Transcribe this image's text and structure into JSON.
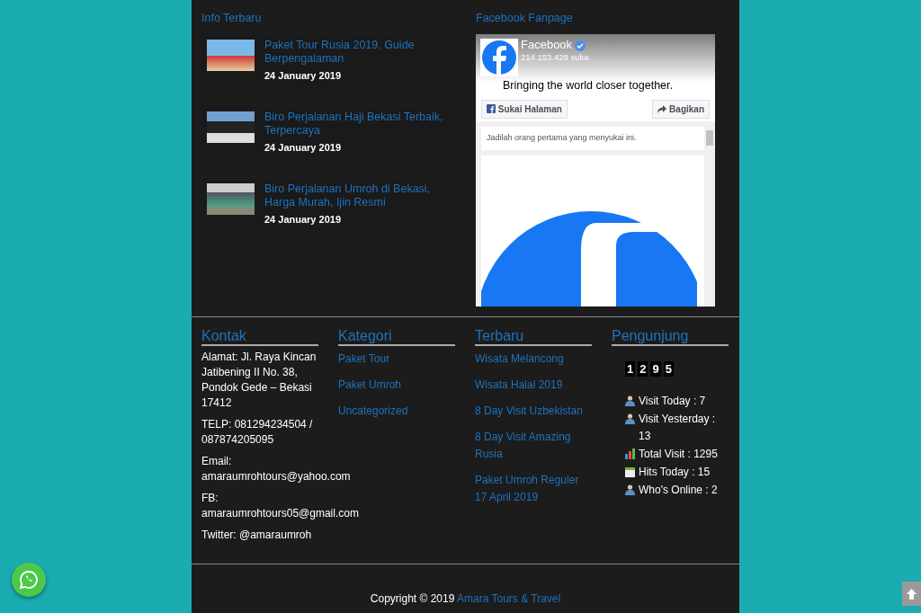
{
  "info_terbaru": {
    "title": "Info Terbaru",
    "posts": [
      {
        "title": "Paket Tour Rusia 2019, Guide Berpengalaman",
        "date": "24 January 2019"
      },
      {
        "title": "Biro Perjalanan Haji Bekasi Terbaik, Terpercaya",
        "date": "24 January 2019"
      },
      {
        "title": "Biro Perjalanan Umroh di Bekasi, Harga Murah, Ijin Resmi",
        "date": "24 January 2019"
      }
    ]
  },
  "facebook_fanpage": {
    "title": "Facebook Fanpage",
    "page_name": "Facebook",
    "likes": "214.153.428 suka",
    "tagline": "Bringing the world closer together.",
    "like_button": "Sukai Halaman",
    "share_button": "Bagikan",
    "note": "Jadilah orang pertama yang menyukai ini."
  },
  "footer": {
    "kontak": {
      "title": "Kontak",
      "lines": [
        "Alamat: Jl. Raya Kincan Jatibening II No. 38, Pondok Gede – Bekasi 17412",
        "TELP: 081294234504 / 087874205095",
        "Email: amaraumrohtours@yahoo.com",
        "FB: amaraumrohtours05@gmail.com",
        "Twitter: @amaraumroh"
      ]
    },
    "kategori": {
      "title": "Kategori",
      "links": [
        "Paket Tour",
        "Paket Umroh",
        "Uncategorized"
      ]
    },
    "terbaru": {
      "title": "Terbaru",
      "links": [
        "Wisata Melancong",
        "Wisata Halal 2019",
        "8 Day Visit Uzbekistan",
        "8 Day Visit Amazing Rusia",
        "Paket Umroh Reguler 17 April 2019"
      ]
    },
    "pengunjung": {
      "title": "Pengunjung",
      "counter": [
        "1",
        "2",
        "9",
        "5"
      ],
      "stats": [
        {
          "kind": "user",
          "text": "Visit Today : 7"
        },
        {
          "kind": "user",
          "text": "Visit Yesterday : 13"
        },
        {
          "kind": "chart",
          "text": "Total Visit : 1295"
        },
        {
          "kind": "calendar",
          "text": "Hits Today : 15"
        },
        {
          "kind": "user",
          "text": "Who's Online : 2"
        }
      ]
    }
  },
  "copyright": {
    "text": "Copyright © 2019",
    "link": "Amara Tours & Travel"
  }
}
